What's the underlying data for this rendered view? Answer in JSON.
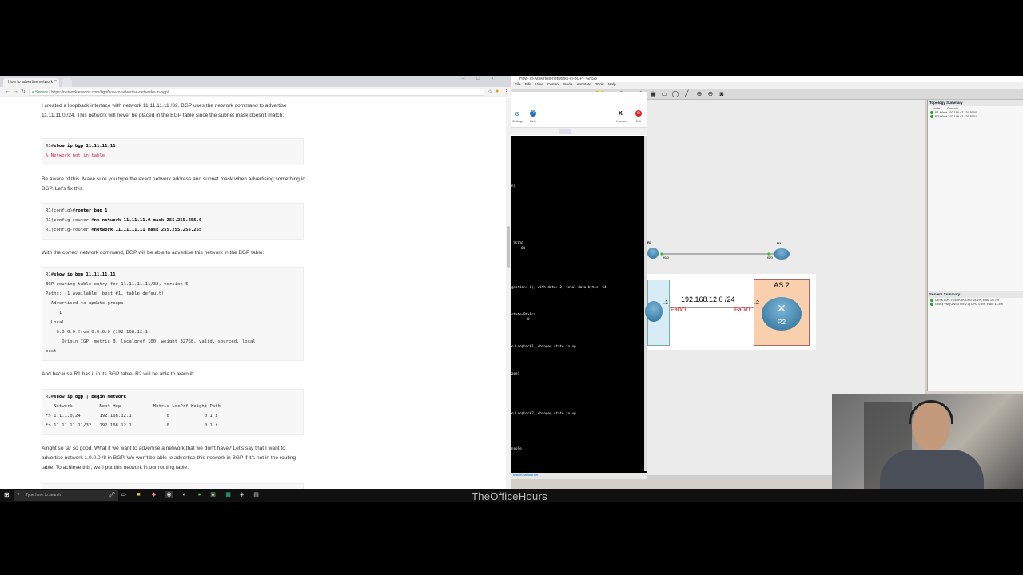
{
  "browser": {
    "tab_title": "How to advertise network",
    "url_secure": "Secure",
    "url": "https://networklessons.com/bgp/how-to-advertise-networks-in-bgp/",
    "paragraphs": {
      "p1": "I created a loopback interface with network 11.11.11.11 /32. BGP uses the network command to advertise 11.11.11.0 /24. This network will never be placed in the BGP table since the subnet mask doesn't match:",
      "p2": "Be aware of this. Make sure you type the exact network address and subnet mask when advertising something in BGP. Let's fix this:",
      "p3": "With the correct network command, BGP will be able to advertise this network in the BGP table:",
      "p4": "And because R1 has it in its BGP table, R2 will be able to learn it:",
      "p5": "Alright so far so good. What if we want to advertise a network that we don't have? Let's say that I want to advertise network 1.0.0.0 /8 in BGP. We won't be able to advertise this network in BGP if it's not in the routing table. To achieve this, we'll put this network in our routing table:"
    },
    "code1": {
      "prompt": "R1#",
      "cmd": "show ip bgp 11.11.11.11",
      "out": "% Network not in table"
    },
    "code2": {
      "l1_prompt": "R1(config)#",
      "l1_cmd": "router bgp 1",
      "l2_prompt": "R1(config-router)#",
      "l2_cmd": "no network 11.11.11.0 mask 255.255.255.0",
      "l3_prompt": "R1(config-router)#",
      "l3_cmd": "network 11.11.11.11 mask 255.255.255.255"
    },
    "code3": {
      "prompt": "R1#",
      "cmd": "show ip bgp 11.11.11.11",
      "out": "BGP routing table entry for 11.11.11.11/32, version 5\nPaths: (1 available, best #1, table default)\n  Advertised to update-groups:\n     1\n  Local\n    0.0.0.0 from 0.0.0.0 (192.168.12.1)\n      Origin IGP, metric 0, localpref 100, weight 32768, valid, sourced, local,\nbest"
    },
    "code4": {
      "prompt": "R2#",
      "cmd": "show ip bgp | begin Network",
      "out": "   Network          Next Hop            Metric LocPrf Weight Path\n*> 1.1.1.0/24       192.168.12.1             0             0 1 i\n*> 11.11.11.11/32   192.168.12.1             0             0 1 i"
    }
  },
  "gns3": {
    "title": "How-To-Advertise-networks-in-BGP - GNS3",
    "menu": [
      "File",
      "Edit",
      "View",
      "Control",
      "Node",
      "Annotate",
      "Tools",
      "Help"
    ],
    "topology_summary": {
      "title": "Topology Summary",
      "col_node": "Node",
      "col_console": "Console",
      "rows": [
        "R1  telnet 192.168.47.129:5000",
        "R2  telnet 192.168.47.129:5001"
      ]
    },
    "servers_summary": {
      "title": "Servers Summary",
      "rows": [
        "DESKTOP-TG6VKBK CPU 14.1%, RAM 26.7%",
        "GNS3 VM (GNS3 VM 2.0) CPU 0.5%, RAM 11.4%"
      ]
    },
    "canvas": {
      "r1_label": "R1",
      "r2_label": "R2",
      "r1_if": "f0/0",
      "r2_if": "f0/0"
    },
    "diagram": {
      "as2": "AS 2",
      "network": "192.168.12.0 /24",
      "left_if": "Fa0/0",
      "right_if": "Fa0/0",
      "left_num": ".1",
      "right_num": ".2",
      "r2": "R2"
    }
  },
  "console": {
    "settings": "Settings",
    "help": "Help",
    "xserver": "X server",
    "exit": "Exit",
    "lines": [
      "n)",
      "16320",
      "64",
      "gestion: 0), with data: 2, total data bytes: 64",
      "state/PfxRcd",
      "0",
      "o Loopback1, changed state to up",
      "ace)",
      "o Loopback2, changed state to up",
      "nsole"
    ],
    "status": "system.netbook.net"
  },
  "taskbar": {
    "search": "Type here to search"
  },
  "brand": "TheOfficeHours"
}
